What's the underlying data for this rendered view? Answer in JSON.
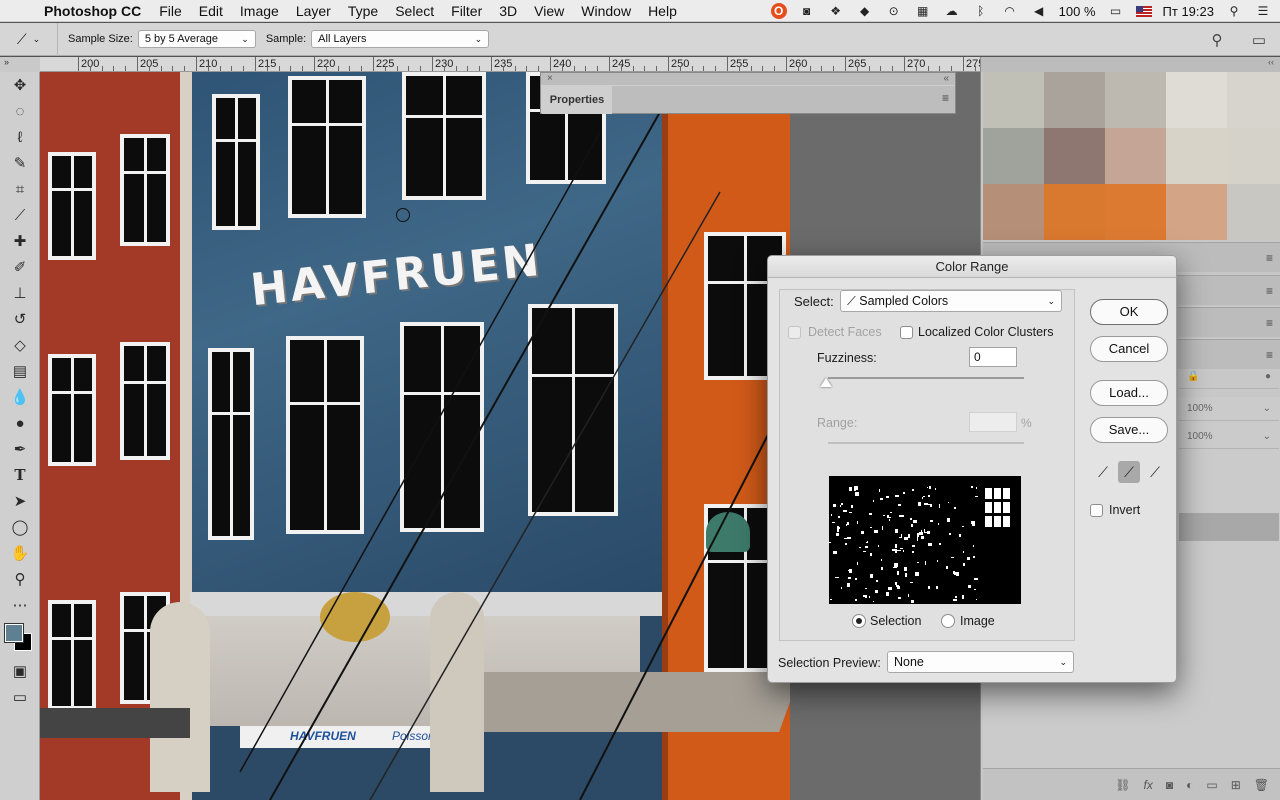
{
  "menubar": {
    "app": "Photoshop CC",
    "items": [
      "File",
      "Edit",
      "Image",
      "Layer",
      "Type",
      "Select",
      "Filter",
      "3D",
      "View",
      "Window",
      "Help"
    ],
    "battery": "100 %",
    "clock": "Пт 19:23"
  },
  "options": {
    "sample_size_label": "Sample Size:",
    "sample_size_value": "5 by 5 Average",
    "sample_label": "Sample:",
    "sample_value": "All Layers"
  },
  "ruler": {
    "labels": [
      "200",
      "205",
      "210",
      "215",
      "220",
      "225",
      "230",
      "235",
      "240",
      "245",
      "250",
      "255",
      "260",
      "265",
      "270",
      "275"
    ]
  },
  "canvas": {
    "sign_text": "HAVFRUEN",
    "awning_text": "HAVFRUEN",
    "awning_text2": "Poissons"
  },
  "properties": {
    "title": "Properties"
  },
  "swatches": {
    "colors": [
      "#c1c0b6",
      "#a9a39c",
      "#bdb9b1",
      "#dedcd4",
      "#d7d4cd",
      "#9fa39c",
      "#8d7770",
      "#c4a596",
      "#d8d3c8",
      "#d5d2c9",
      "#b68f78",
      "#d9782f",
      "#dd7a31",
      "#d3a586",
      "#c9c7c1"
    ]
  },
  "layers": {
    "opacity": "100%",
    "fill": "100%"
  },
  "dialog": {
    "title": "Color Range",
    "select_label": "Select:",
    "select_value": "Sampled Colors",
    "detect_faces": "Detect Faces",
    "localized": "Localized Color Clusters",
    "fuzziness_label": "Fuzziness:",
    "fuzziness_value": "0",
    "range_label": "Range:",
    "range_unit": "%",
    "selection_radio": "Selection",
    "image_radio": "Image",
    "preview_label": "Selection Preview:",
    "preview_value": "None",
    "ok": "OK",
    "cancel": "Cancel",
    "load": "Load...",
    "save": "Save...",
    "invert": "Invert"
  }
}
